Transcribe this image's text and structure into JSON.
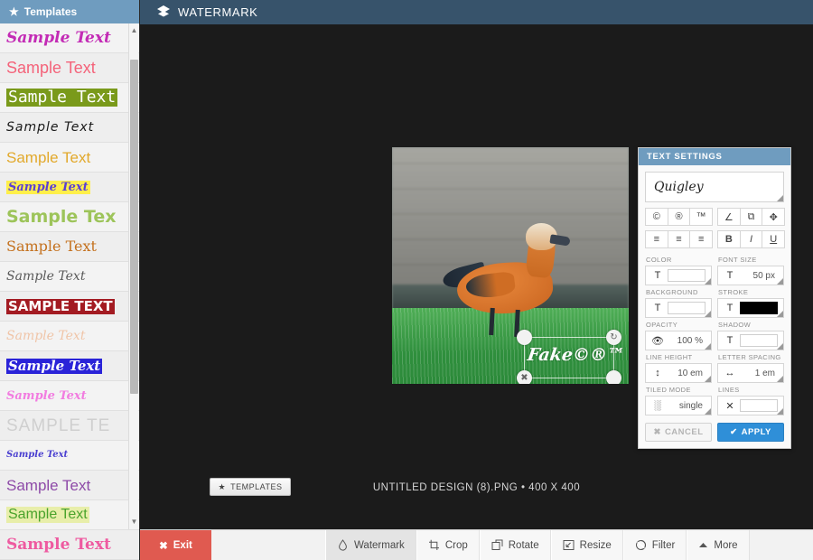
{
  "sidebar": {
    "header_label": "Templates",
    "header_icon": "star-icon",
    "templates": [
      {
        "text": "Sample Text",
        "color": "#c32bb5",
        "bg": "transparent",
        "family": "\"DejaVu Serif\", serif",
        "style": "italic",
        "weight": "bold",
        "size": "17px",
        "spacing": "0px"
      },
      {
        "text": "Sample Text",
        "color": "#f4637a",
        "bg": "transparent",
        "family": "\"Liberation Sans\", sans-serif",
        "style": "normal",
        "weight": "normal",
        "size": "18px",
        "spacing": "0px"
      },
      {
        "text": "Sample Text",
        "color": "#ffffff",
        "bg": "#7a9a1b",
        "family": "\"DejaVu Sans Mono\", monospace",
        "style": "normal",
        "weight": "normal",
        "size": "18px",
        "spacing": "0px"
      },
      {
        "text": "Sample Text",
        "color": "#1a1a1a",
        "bg": "transparent",
        "family": "\"DejaVu Sans\", sans-serif",
        "style": "italic",
        "weight": "normal",
        "size": "14px",
        "spacing": "1px"
      },
      {
        "text": "Sample Text",
        "color": "#e2a92c",
        "bg": "transparent",
        "family": "\"Liberation Sans\", sans-serif",
        "style": "normal",
        "weight": "normal",
        "size": "17px",
        "spacing": "0px"
      },
      {
        "text": "Sample Text",
        "color": "#5a3fd4",
        "bg": "#ffef4a",
        "family": "\"DejaVu Serif\", serif",
        "style": "italic",
        "weight": "bold",
        "size": "13px",
        "spacing": "0px"
      },
      {
        "text": "Sample Tex",
        "color": "#9dc45a",
        "bg": "transparent",
        "family": "\"DejaVu Sans\", sans-serif",
        "style": "normal",
        "weight": "bold",
        "size": "19px",
        "spacing": "0px"
      },
      {
        "text": "Sample Text",
        "color": "#c4711e",
        "bg": "transparent",
        "family": "\"DejaVu Serif\", serif",
        "style": "normal",
        "weight": "normal",
        "size": "16px",
        "spacing": "0px"
      },
      {
        "text": "Sample Text",
        "color": "#5a5a5a",
        "bg": "transparent",
        "family": "\"DejaVu Serif\", serif",
        "style": "italic",
        "weight": "normal",
        "size": "14px",
        "spacing": "0px"
      },
      {
        "text": "SAMPLE TEXT",
        "color": "#ffffff",
        "bg": "#a31b22",
        "family": "\"DejaVu Sans\", sans-serif",
        "style": "normal",
        "weight": "bold",
        "size": "15px",
        "spacing": "0px"
      },
      {
        "text": "Sample Text",
        "color": "#f0c5a8",
        "bg": "transparent",
        "family": "\"DejaVu Serif\", serif",
        "style": "italic",
        "weight": "normal",
        "size": "14px",
        "spacing": "0px"
      },
      {
        "text": "Sample Text",
        "color": "#ffffff",
        "bg": "#2a23d8",
        "family": "\"DejaVu Serif\", serif",
        "style": "italic",
        "weight": "bold",
        "size": "15px",
        "spacing": "0px"
      },
      {
        "text": "Sample Text",
        "color": "#f27ce0",
        "bg": "transparent",
        "family": "\"DejaVu Serif\", serif",
        "style": "italic",
        "weight": "bold",
        "size": "13px",
        "spacing": "0px"
      },
      {
        "text": "SAMPLE TE",
        "color": "#cfcfcf",
        "bg": "transparent",
        "family": "\"Liberation Sans\", sans-serif",
        "style": "normal",
        "weight": "normal",
        "size": "19px",
        "spacing": "1px"
      },
      {
        "text": "Sample Text",
        "color": "#4a3fd0",
        "bg": "transparent",
        "family": "\"DejaVu Serif\", serif",
        "style": "italic",
        "weight": "bold",
        "size": "10px",
        "spacing": "0px"
      },
      {
        "text": "Sample Text",
        "color": "#8e4ba8",
        "bg": "transparent",
        "family": "\"Liberation Sans\", sans-serif",
        "style": "normal",
        "weight": "normal",
        "size": "17px",
        "spacing": "0px"
      },
      {
        "text": "Sample Text",
        "color": "#4aa32c",
        "bg": "#e8eeaa",
        "family": "\"Liberation Sans\", sans-serif",
        "style": "normal",
        "weight": "normal",
        "size": "16px",
        "spacing": "0px"
      },
      {
        "text": "Sample Text",
        "color": "#ee5aa0",
        "bg": "transparent",
        "family": "\"DejaVu Serif\", serif",
        "style": "normal",
        "weight": "bold",
        "size": "17px",
        "spacing": "0px"
      }
    ],
    "scroll_up_glyph": "▲",
    "scroll_down_glyph": "▼"
  },
  "topbar": {
    "title": "WATERMARK",
    "icon": "layers-icon"
  },
  "canvas": {
    "image_alt": "ruddy shelduck standing on grass in front of a stone wall",
    "watermark": {
      "text": "Fake©®™",
      "handle_rotate": "↻",
      "handle_delete": "✖",
      "handle_move": "",
      "handle_resize": ""
    },
    "templates_button": {
      "label": "TEMPLATES",
      "icon": "star-icon"
    },
    "status": "UNTITLED DESIGN (8).PNG • 400 X 400"
  },
  "text_settings": {
    "title": "TEXT SETTINGS",
    "font": {
      "value": "Quigley"
    },
    "symbol_buttons": [
      {
        "name": "copyright-button",
        "glyph": "©"
      },
      {
        "name": "registered-button",
        "glyph": "®"
      },
      {
        "name": "trademark-button",
        "glyph": "™"
      }
    ],
    "transform_buttons": [
      {
        "name": "rotate-angle-button",
        "glyph": "∠"
      },
      {
        "name": "duplicate-button",
        "glyph": "⧉"
      },
      {
        "name": "move-button",
        "glyph": "✥"
      }
    ],
    "align_buttons": [
      {
        "name": "align-left-button",
        "glyph": "≡"
      },
      {
        "name": "align-center-button",
        "glyph": "≡"
      },
      {
        "name": "align-right-button",
        "glyph": "≡"
      }
    ],
    "style_buttons": [
      {
        "name": "bold-button",
        "glyph": "B"
      },
      {
        "name": "italic-button",
        "glyph": "I"
      },
      {
        "name": "underline-button",
        "glyph": "U"
      }
    ],
    "fields": [
      {
        "label": "COLOR",
        "icon": "T",
        "type": "swatch",
        "value": "",
        "swatch": "#ffffff"
      },
      {
        "label": "FONT SIZE",
        "icon": "T",
        "type": "value",
        "value": "50 px",
        "swatch": ""
      },
      {
        "label": "BACKGROUND",
        "icon": "T",
        "type": "swatch",
        "value": "",
        "swatch": "#ffffff"
      },
      {
        "label": "STROKE",
        "icon": "T",
        "type": "swatch",
        "value": "",
        "swatch": "#000000"
      },
      {
        "label": "OPACITY",
        "icon": "👁",
        "type": "value",
        "value": "100 %",
        "swatch": ""
      },
      {
        "label": "SHADOW",
        "icon": "T",
        "type": "swatch",
        "value": "",
        "swatch": "#ffffff"
      },
      {
        "label": "LINE HEIGHT",
        "icon": "↕",
        "type": "value",
        "value": "10 em",
        "swatch": ""
      },
      {
        "label": "LETTER SPACING",
        "icon": "↔",
        "type": "value",
        "value": "1 em",
        "swatch": ""
      },
      {
        "label": "TILED MODE",
        "icon": "░",
        "type": "value",
        "value": "single",
        "swatch": ""
      },
      {
        "label": "LINES",
        "icon": "✕",
        "type": "swatch",
        "value": "",
        "swatch": "#ffffff"
      }
    ],
    "cancel_label": "CANCEL",
    "cancel_icon": "✖",
    "apply_label": "APPLY",
    "apply_icon": "✔"
  },
  "toolbar": {
    "exit_label": "Exit",
    "exit_icon": "✖",
    "items": [
      {
        "label": "Watermark",
        "icon": "droplet-icon",
        "active": true
      },
      {
        "label": "Crop",
        "icon": "crop-icon",
        "active": false
      },
      {
        "label": "Rotate",
        "icon": "rotate-icon",
        "active": false
      },
      {
        "label": "Resize",
        "icon": "resize-icon",
        "active": false
      },
      {
        "label": "Filter",
        "icon": "filter-icon",
        "active": false
      },
      {
        "label": "More",
        "icon": "caret-up-icon",
        "active": false
      }
    ]
  },
  "colors": {
    "header_blue": "#6f9cbf",
    "topbar_blue": "#37536b",
    "apply_blue": "#2f8fd8",
    "exit_red": "#e05a50",
    "canvas_bg": "#1b1b1b"
  }
}
